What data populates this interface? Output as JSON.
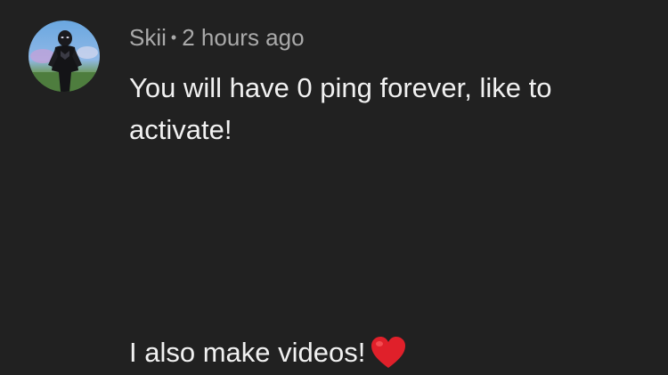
{
  "comment": {
    "author": "Skii",
    "separator": "•",
    "timestamp": "2 hours ago",
    "text_line1": "You will have 0 ping forever, like to",
    "text_line2": "activate!",
    "text_line3": "I also make videos!",
    "emoji_icon": "red-heart-icon"
  },
  "colors": {
    "background": "#212121",
    "meta_text": "#aaaaaa",
    "body_text": "#f1f1f1",
    "heart": "#e0202a"
  }
}
